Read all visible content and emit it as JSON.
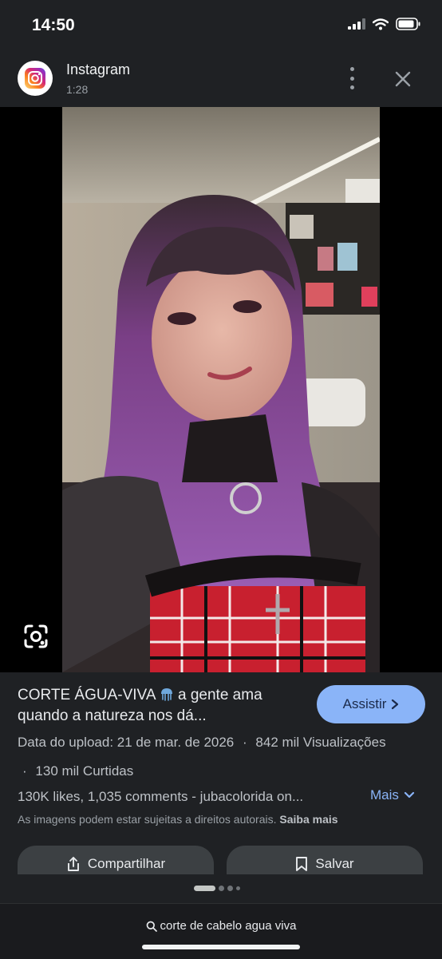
{
  "status_bar": {
    "time": "14:50",
    "icons": [
      "cellular-signal-icon",
      "wifi-icon",
      "battery-icon"
    ]
  },
  "header": {
    "app_name": "Instagram",
    "duration": "1:28",
    "icon": "instagram-icon"
  },
  "result": {
    "title_part1": "CORTE ÁGUA-VIVA",
    "title_emoji_icon": "jellyfish-icon",
    "title_part2": "a gente ama quando a natureza nos dá...",
    "visit_button": "Assistir",
    "upload_date": "Data do upload: 21 de mar. de 2026",
    "separator": "·",
    "views": "842 mil Visualizações",
    "likes_count": "130 mil Curtidas",
    "description": "130K likes, 1,035 comments - jubacolorida on...",
    "more_button": "Mais",
    "copyright_notice": "As imagens podem estar sujeitas a direitos autorais.",
    "learn_more": "Saiba mais"
  },
  "actions": {
    "share": "Compartilhar",
    "save": "Salvar"
  },
  "pager": {
    "total": 4,
    "active_index": 0
  },
  "bottom": {
    "search_query": "corte de cabelo agua viva"
  },
  "colors": {
    "background": "#1f2124",
    "accent": "#8ab4f8",
    "button_bg": "#3c4043"
  }
}
